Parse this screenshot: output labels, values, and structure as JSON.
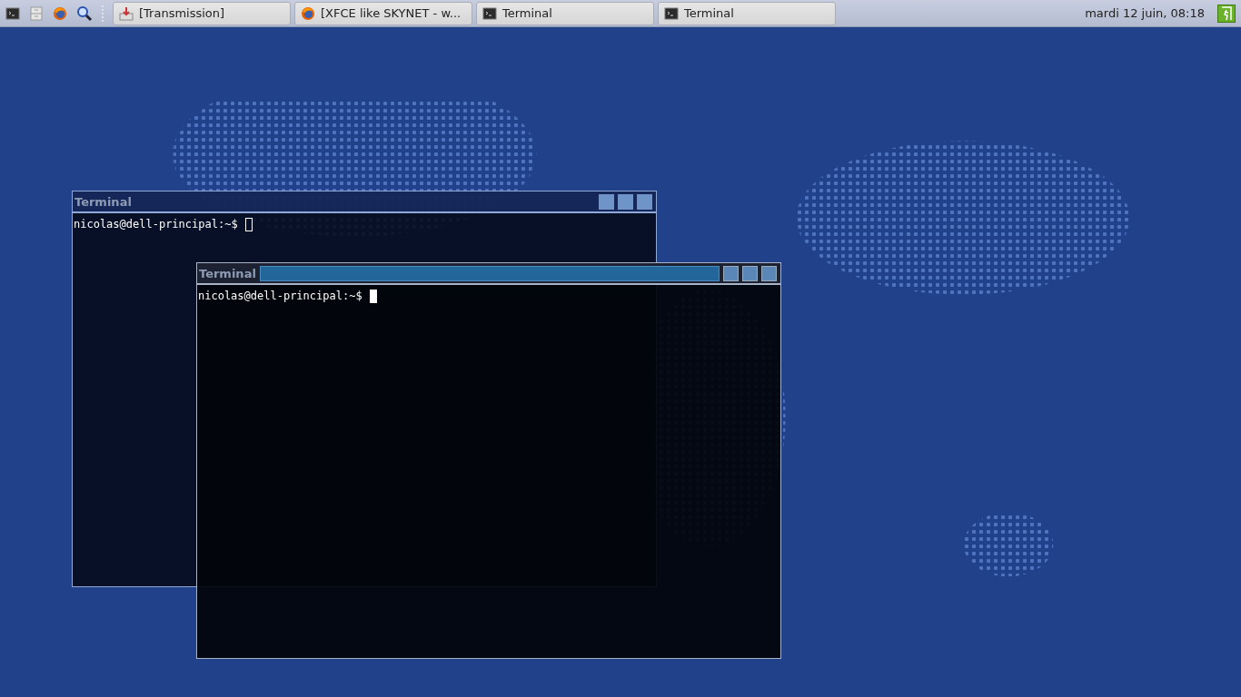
{
  "panel": {
    "tasks": [
      {
        "kind": "download",
        "label": "[Transmission]"
      },
      {
        "kind": "browser",
        "label": "[XFCE like SKYNET - w..."
      },
      {
        "kind": "terminal",
        "label": "Terminal"
      },
      {
        "kind": "terminal",
        "label": "Terminal"
      }
    ],
    "clock": "mardi 12 juin, 08:18"
  },
  "windows": [
    {
      "title": "Terminal",
      "prompt": "nicolas@dell-principal:~$",
      "focused": false
    },
    {
      "title": "Terminal",
      "prompt": "nicolas@dell-principal:~$",
      "focused": true
    }
  ]
}
